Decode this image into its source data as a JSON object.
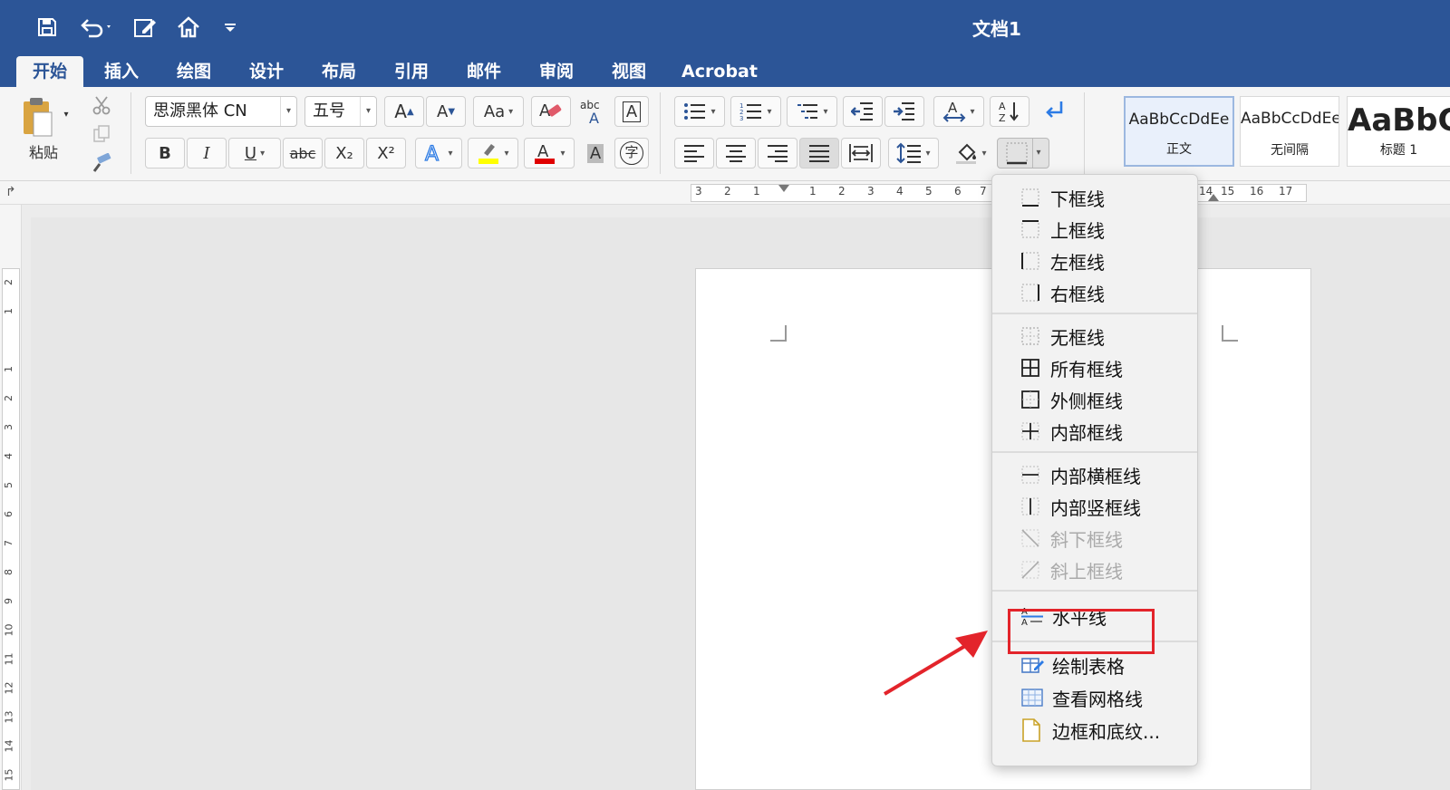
{
  "window": {
    "title": "文档1"
  },
  "quick_access": [
    {
      "icon": "save-icon"
    },
    {
      "icon": "undo-icon"
    },
    {
      "icon": "edit-doc-icon"
    },
    {
      "icon": "home-icon"
    },
    {
      "icon": "customize-icon"
    }
  ],
  "tabs": [
    {
      "label": "开始",
      "active": true
    },
    {
      "label": "插入"
    },
    {
      "label": "绘图"
    },
    {
      "label": "设计"
    },
    {
      "label": "布局"
    },
    {
      "label": "引用"
    },
    {
      "label": "邮件"
    },
    {
      "label": "审阅"
    },
    {
      "label": "视图"
    },
    {
      "label": "Acrobat"
    }
  ],
  "ribbon": {
    "paste_label": "粘贴",
    "font_name": "思源黑体 CN",
    "font_size": "五号",
    "btn_bold": "B",
    "btn_italic": "I",
    "btn_underline": "U",
    "btn_strike": "abc",
    "btn_sub": "X₂",
    "btn_sup": "X²",
    "btn_grow": "A",
    "btn_shrink": "A",
    "btn_case": "Aa",
    "btn_phonetic": "abc",
    "btn_charborder": "A",
    "btn_shading": "A",
    "btn_enclose": "字",
    "highlight_color": "#ffff00",
    "fontcolor_color": "#e00000",
    "styles": [
      {
        "sample": "AaBbCcDdEe",
        "name": "正文",
        "selected": true
      },
      {
        "sample": "AaBbCcDdEe",
        "name": "无间隔"
      },
      {
        "sample": "AaBbC",
        "name": "标题 1"
      }
    ]
  },
  "ruler": {
    "h_numbers": [
      "3",
      "2",
      "1",
      "1",
      "2",
      "3",
      "4",
      "5",
      "6",
      "7",
      "14",
      "15",
      "16",
      "17"
    ],
    "v_numbers": [
      "2",
      "1",
      "1",
      "2",
      "3",
      "4",
      "5",
      "6",
      "7",
      "8",
      "9",
      "10",
      "11",
      "12",
      "13",
      "14",
      "15"
    ]
  },
  "border_menu": {
    "groups": [
      [
        {
          "label": "下框线",
          "icon": "bottom-border-icon"
        },
        {
          "label": "上框线",
          "icon": "top-border-icon"
        },
        {
          "label": "左框线",
          "icon": "left-border-icon"
        },
        {
          "label": "右框线",
          "icon": "right-border-icon"
        }
      ],
      [
        {
          "label": "无框线",
          "icon": "no-border-icon"
        },
        {
          "label": "所有框线",
          "icon": "all-borders-icon"
        },
        {
          "label": "外侧框线",
          "icon": "outside-borders-icon"
        },
        {
          "label": "内部框线",
          "icon": "inside-borders-icon"
        }
      ],
      [
        {
          "label": "内部横框线",
          "icon": "inside-horizontal-border-icon"
        },
        {
          "label": "内部竖框线",
          "icon": "inside-vertical-border-icon"
        },
        {
          "label": "斜下框线",
          "icon": "diagonal-down-border-icon",
          "disabled": true
        },
        {
          "label": "斜上框线",
          "icon": "diagonal-up-border-icon",
          "disabled": true
        }
      ],
      [
        {
          "label": "水平线",
          "icon": "horizontal-line-icon"
        }
      ],
      [
        {
          "label": "绘制表格",
          "icon": "draw-table-icon"
        },
        {
          "label": "查看网格线",
          "icon": "view-gridlines-icon"
        },
        {
          "label": "边框和底纹...",
          "icon": "borders-shading-icon"
        }
      ]
    ]
  },
  "annotation": {
    "color": "#e3242b"
  }
}
